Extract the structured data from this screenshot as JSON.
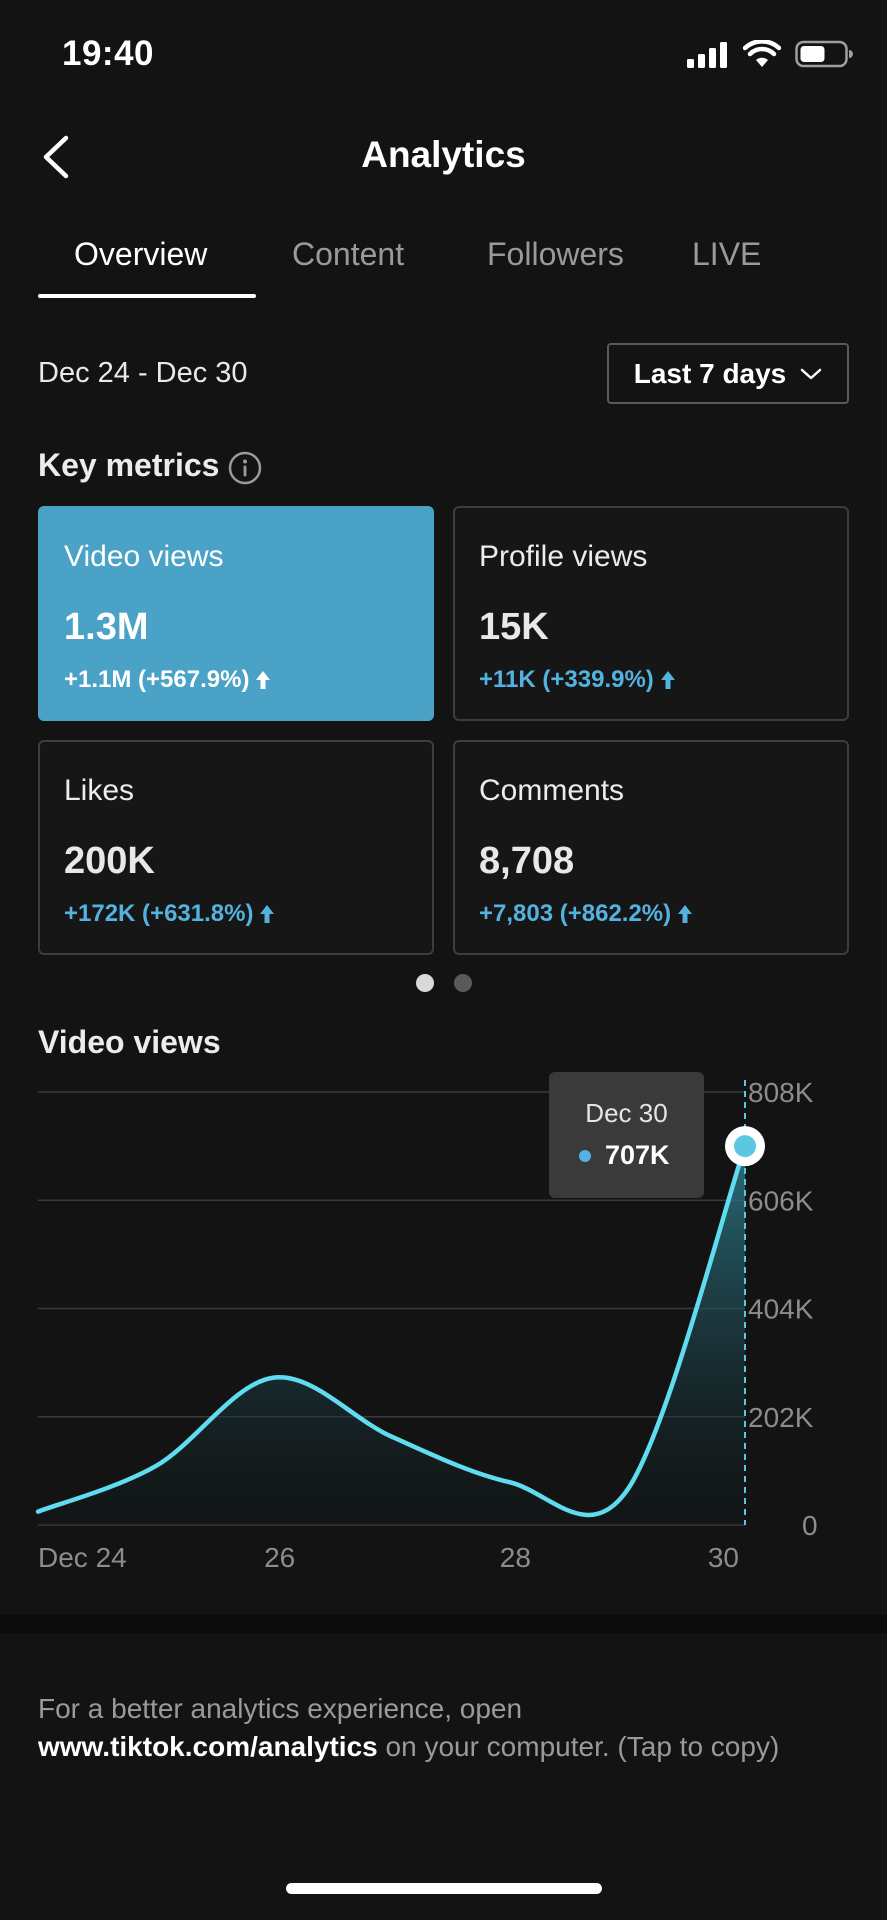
{
  "status_bar": {
    "time": "19:40"
  },
  "header": {
    "title": "Analytics"
  },
  "tabs": [
    {
      "label": "Overview",
      "active": true
    },
    {
      "label": "Content",
      "active": false
    },
    {
      "label": "Followers",
      "active": false
    },
    {
      "label": "LIVE",
      "active": false
    }
  ],
  "date_range": "Dec 24 - Dec 30",
  "period_select": {
    "label": "Last 7 days"
  },
  "key_metrics": {
    "title": "Key metrics",
    "cards": [
      {
        "label": "Video views",
        "value": "1.3M",
        "change": "+1.1M (+567.9%)",
        "active": true
      },
      {
        "label": "Profile views",
        "value": "15K",
        "change": "+11K (+339.9%)",
        "active": false
      },
      {
        "label": "Likes",
        "value": "200K",
        "change": "+172K (+631.8%)",
        "active": false
      },
      {
        "label": "Comments",
        "value": "8,708",
        "change": "+7,803 (+862.2%)",
        "active": false
      }
    ],
    "page_count": 2,
    "current_page": 1
  },
  "chart_section": {
    "title": "Video views"
  },
  "tooltip": {
    "date": "Dec 30",
    "value": "707K"
  },
  "chart_data": {
    "type": "area",
    "title": "Video views",
    "x": [
      "Dec 24",
      "Dec 25",
      "Dec 26",
      "Dec 27",
      "Dec 28",
      "Dec 29",
      "Dec 30"
    ],
    "x_tick_labels": [
      "Dec 24",
      "26",
      "28",
      "30"
    ],
    "y_tick_labels": [
      "808K",
      "606K",
      "404K",
      "202K",
      "0"
    ],
    "ylim": [
      0,
      808000
    ],
    "series": [
      {
        "values": [
          25000,
          110000,
          275000,
          165000,
          80000,
          65000,
          707000
        ]
      }
    ],
    "highlighted_point": {
      "x": "Dec 30",
      "y": 707000
    },
    "grid": true,
    "colors": {
      "line": "#5fdcf0",
      "marker": "#5ac8e0"
    }
  },
  "footer": {
    "text_before": "For a better analytics experience, open",
    "link": "www.tiktok.com/analytics",
    "text_after": " on your computer. (Tap to copy)"
  },
  "colors": {
    "background": "#131313",
    "accent_card": "#4aa2c6",
    "positive_change": "#52b3e0"
  }
}
